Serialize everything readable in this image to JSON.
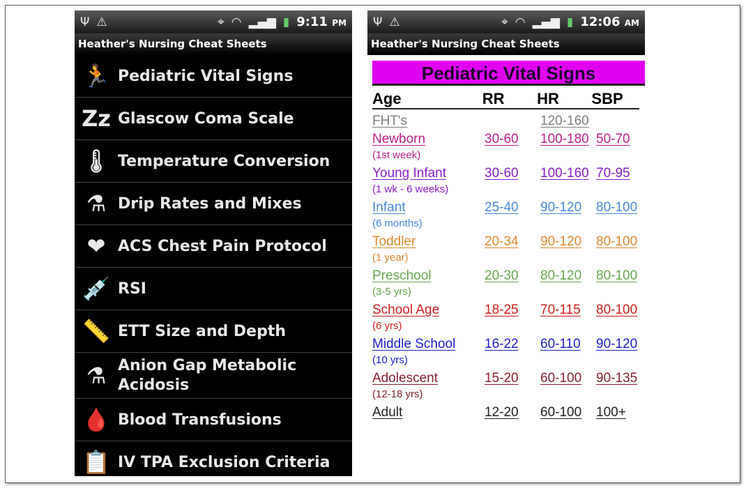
{
  "app_title": "Heather's Nursing Cheat Sheets",
  "left_status": {
    "time": "9:11",
    "ampm": "PM"
  },
  "right_status": {
    "time": "12:06",
    "ampm": "AM"
  },
  "menu": [
    {
      "label": "Pediatric Vital Signs",
      "icon": "running-man-icon",
      "glyph": "🏃"
    },
    {
      "label": "Glascow Coma Scale",
      "icon": "sleep-zzz-icon",
      "glyph": "Zz"
    },
    {
      "label": "Temperature Conversion",
      "icon": "thermometer-icon",
      "glyph": "🌡"
    },
    {
      "label": "Drip Rates and Mixes",
      "icon": "mortar-pestle-icon",
      "glyph": "⚗"
    },
    {
      "label": "ACS Chest Pain Protocol",
      "icon": "heart-ecg-icon",
      "glyph": "❤"
    },
    {
      "label": "RSI",
      "icon": "syringe-icon",
      "glyph": "💉"
    },
    {
      "label": "ETT Size and Depth",
      "icon": "tape-measure-icon",
      "glyph": "📏"
    },
    {
      "label": "Anion Gap Metabolic Acidosis",
      "icon": "flask-icon",
      "glyph": "⚗"
    },
    {
      "label": "Blood Transfusions",
      "icon": "blood-bag-icon",
      "glyph": "🩸"
    },
    {
      "label": "IV TPA Exclusion Criteria",
      "icon": "clipboard-icon",
      "glyph": "📋"
    }
  ],
  "sheet": {
    "title": "Pediatric Vital Signs",
    "headers": [
      "Age",
      "RR",
      "HR",
      "SBP"
    ],
    "rows": [
      {
        "age": "FHT's",
        "sub": "",
        "rr": "",
        "hr": "120-160",
        "sbp": "",
        "color": "#808080"
      },
      {
        "age": "Newborn",
        "sub": "(1st week)",
        "rr": "30-60",
        "hr": "100-180",
        "sbp": "50-70",
        "color": "#c0208a"
      },
      {
        "age": "Young Infant",
        "sub": "(1 wk - 6 weeks)",
        "rr": "30-60",
        "hr": "100-160",
        "sbp": "70-95",
        "color": "#8a20c8"
      },
      {
        "age": "Infant",
        "sub": "(6 months)",
        "rr": "25-40",
        "hr": "90-120",
        "sbp": "80-100",
        "color": "#4a8ae0"
      },
      {
        "age": "Toddler",
        "sub": "(1 year)",
        "rr": "20-34",
        "hr": "90-120",
        "sbp": "80-100",
        "color": "#e08a30"
      },
      {
        "age": "Preschool",
        "sub": "(3-5 yrs)",
        "rr": "20-30",
        "hr": "80-120",
        "sbp": "80-100",
        "color": "#6aa84f"
      },
      {
        "age": "School Age",
        "sub": "(6 yrs)",
        "rr": "18-25",
        "hr": "70-115",
        "sbp": "80-100",
        "color": "#d02020"
      },
      {
        "age": "Middle School",
        "sub": "(10 yrs)",
        "rr": "16-22",
        "hr": "60-110",
        "sbp": "90-120",
        "color": "#2020d0"
      },
      {
        "age": "Adolescent",
        "sub": "(12-18 yrs)",
        "rr": "15-20",
        "hr": "60-100",
        "sbp": "90-135",
        "color": "#8a2030"
      },
      {
        "age": "Adult",
        "sub": "",
        "rr": "12-20",
        "hr": "60-100",
        "sbp": "100+",
        "color": "#222222"
      }
    ]
  }
}
